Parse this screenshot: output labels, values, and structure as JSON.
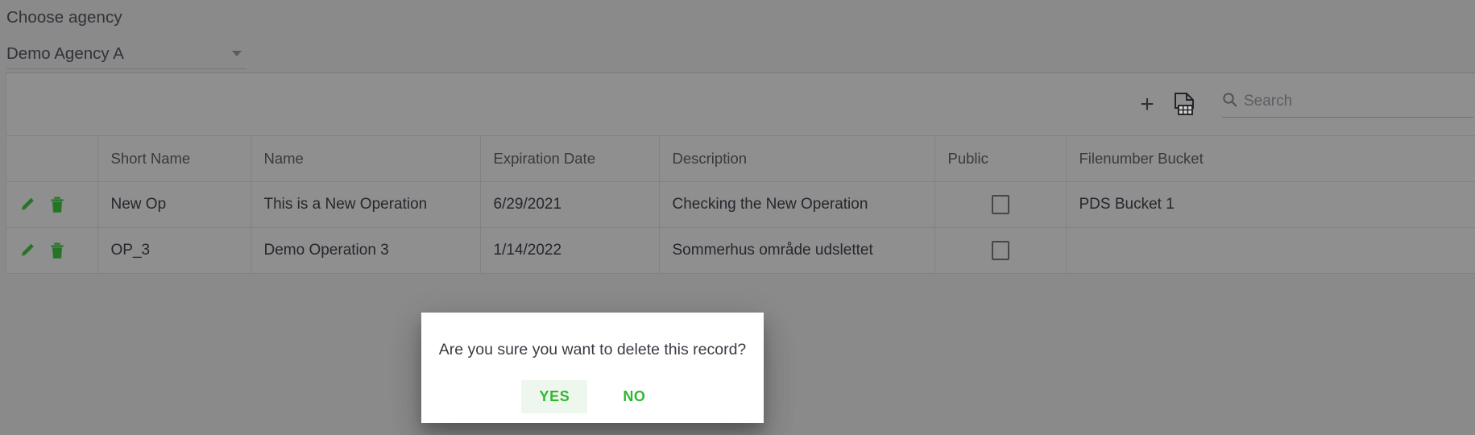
{
  "agency": {
    "label": "Choose agency",
    "selected": "Demo Agency A",
    "caret_icon": "chevron-down-icon"
  },
  "toolbar": {
    "add_label": "+",
    "add_icon": "plus-icon",
    "export_icon": "export-file-icon",
    "search": {
      "icon": "search-icon",
      "placeholder": "Search",
      "value": ""
    }
  },
  "table": {
    "columns": [
      {
        "key": "actions",
        "label": ""
      },
      {
        "key": "short_name",
        "label": "Short Name"
      },
      {
        "key": "name",
        "label": "Name"
      },
      {
        "key": "expiration_date",
        "label": "Expiration Date"
      },
      {
        "key": "description",
        "label": "Description"
      },
      {
        "key": "public",
        "label": "Public"
      },
      {
        "key": "filenumber_bucket",
        "label": "Filenumber Bucket"
      }
    ],
    "row_actions": {
      "edit_icon": "pencil-edit-icon",
      "delete_icon": "trash-delete-icon"
    },
    "rows": [
      {
        "short_name": "New Op",
        "name": "This is a New Operation",
        "expiration_date": "6/29/2021",
        "description": "Checking the New Operation",
        "public": false,
        "filenumber_bucket": "PDS Bucket 1"
      },
      {
        "short_name": "OP_3",
        "name": "Demo Operation 3",
        "expiration_date": "1/14/2022",
        "description": "Sommerhus område udslettet",
        "public": false,
        "filenumber_bucket": ""
      }
    ]
  },
  "dialog": {
    "message": "Are you sure you want to delete this record?",
    "confirm_label": "YES",
    "cancel_label": "NO"
  },
  "colors": {
    "page_background": "#a5a5a5",
    "card_background": "#ababab",
    "action_icon_green": "#2e8b2e",
    "dialog_button_green": "#2eb82e",
    "text_primary": "#2e2e36",
    "text_secondary": "#6f6f76"
  }
}
